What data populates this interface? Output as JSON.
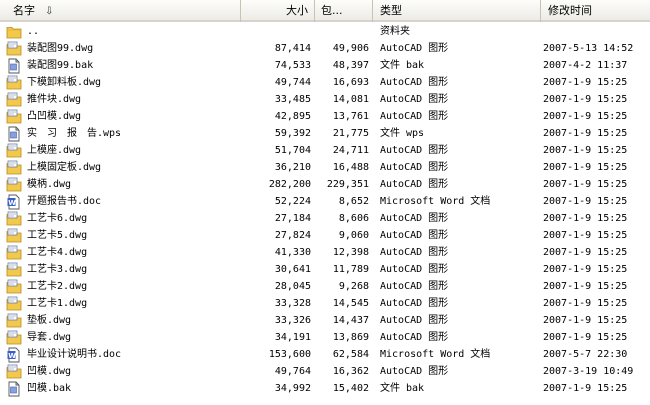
{
  "columns": {
    "name": "名字",
    "size": "大小",
    "packed": "包...",
    "type": "类型",
    "modified": "修改时间"
  },
  "sort_icon": "sort-down-arrow-icon",
  "colors": {
    "header_bg": "#ecebe6",
    "folder_yellow": "#f2c94c",
    "doc_blue": "#3a5fc8"
  },
  "files": [
    {
      "icon": "folder",
      "name": "..",
      "size": "",
      "packed": "",
      "type": "资料夹",
      "modified": ""
    },
    {
      "icon": "dwg",
      "name": "装配图99.dwg",
      "size": "87,414",
      "packed": "49,906",
      "type": "AutoCAD 图形",
      "modified": "2007-5-13 14:52"
    },
    {
      "icon": "file",
      "name": "装配图99.bak",
      "size": "74,533",
      "packed": "48,397",
      "type": "文件 bak",
      "modified": "2007-4-2 11:37"
    },
    {
      "icon": "dwg",
      "name": "下模卸料板.dwg",
      "size": "49,744",
      "packed": "16,693",
      "type": "AutoCAD 图形",
      "modified": "2007-1-9 15:25"
    },
    {
      "icon": "dwg",
      "name": "推件块.dwg",
      "size": "33,485",
      "packed": "14,081",
      "type": "AutoCAD 图形",
      "modified": "2007-1-9 15:25"
    },
    {
      "icon": "dwg",
      "name": "凸凹模.dwg",
      "size": "42,895",
      "packed": "13,761",
      "type": "AutoCAD 图形",
      "modified": "2007-1-9 15:25"
    },
    {
      "icon": "file",
      "name": "实　习　报　告.wps",
      "size": "59,392",
      "packed": "21,775",
      "type": "文件 wps",
      "modified": "2007-1-9 15:25"
    },
    {
      "icon": "dwg",
      "name": "上模座.dwg",
      "size": "51,704",
      "packed": "24,711",
      "type": "AutoCAD 图形",
      "modified": "2007-1-9 15:25"
    },
    {
      "icon": "dwg",
      "name": "上模固定板.dwg",
      "size": "36,210",
      "packed": "16,488",
      "type": "AutoCAD 图形",
      "modified": "2007-1-9 15:25"
    },
    {
      "icon": "dwg",
      "name": "模柄.dwg",
      "size": "282,200",
      "packed": "229,351",
      "type": "AutoCAD 图形",
      "modified": "2007-1-9 15:25"
    },
    {
      "icon": "doc",
      "name": "开题报告书.doc",
      "size": "52,224",
      "packed": "8,652",
      "type": "Microsoft Word 文档",
      "modified": "2007-1-9 15:25"
    },
    {
      "icon": "dwg",
      "name": "工艺卡6.dwg",
      "size": "27,184",
      "packed": "8,606",
      "type": "AutoCAD 图形",
      "modified": "2007-1-9 15:25"
    },
    {
      "icon": "dwg",
      "name": "工艺卡5.dwg",
      "size": "27,824",
      "packed": "9,060",
      "type": "AutoCAD 图形",
      "modified": "2007-1-9 15:25"
    },
    {
      "icon": "dwg",
      "name": "工艺卡4.dwg",
      "size": "41,330",
      "packed": "12,398",
      "type": "AutoCAD 图形",
      "modified": "2007-1-9 15:25"
    },
    {
      "icon": "dwg",
      "name": "工艺卡3.dwg",
      "size": "30,641",
      "packed": "11,789",
      "type": "AutoCAD 图形",
      "modified": "2007-1-9 15:25"
    },
    {
      "icon": "dwg",
      "name": "工艺卡2.dwg",
      "size": "28,045",
      "packed": "9,268",
      "type": "AutoCAD 图形",
      "modified": "2007-1-9 15:25"
    },
    {
      "icon": "dwg",
      "name": "工艺卡1.dwg",
      "size": "33,328",
      "packed": "14,545",
      "type": "AutoCAD 图形",
      "modified": "2007-1-9 15:25"
    },
    {
      "icon": "dwg",
      "name": "垫板.dwg",
      "size": "33,326",
      "packed": "14,437",
      "type": "AutoCAD 图形",
      "modified": "2007-1-9 15:25"
    },
    {
      "icon": "dwg",
      "name": "导套.dwg",
      "size": "34,191",
      "packed": "13,869",
      "type": "AutoCAD 图形",
      "modified": "2007-1-9 15:25"
    },
    {
      "icon": "doc",
      "name": "毕业设计说明书.doc",
      "size": "153,600",
      "packed": "62,584",
      "type": "Microsoft Word 文档",
      "modified": "2007-5-7 22:30"
    },
    {
      "icon": "dwg",
      "name": "凹模.dwg",
      "size": "49,764",
      "packed": "16,362",
      "type": "AutoCAD 图形",
      "modified": "2007-3-19 10:49"
    },
    {
      "icon": "file",
      "name": "凹模.bak",
      "size": "34,992",
      "packed": "15,402",
      "type": "文件 bak",
      "modified": "2007-1-9 15:25"
    }
  ]
}
